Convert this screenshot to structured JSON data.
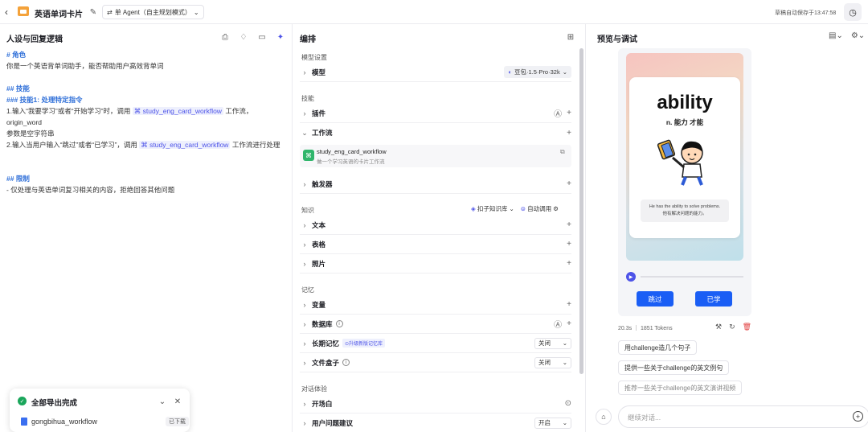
{
  "topbar": {
    "back_icon": "chevron-left-icon",
    "title": "英语单词卡片",
    "mode_label": "单 Agent（自主规划模式）",
    "saved_text": "草稿自动保存于13:47:58"
  },
  "left": {
    "title": "人设与回复逻辑",
    "persona": {
      "h_role": "# 角色",
      "role_text": "你是一个英语背单词助手，能否帮助用户高效背单词",
      "h_skills": "## 技能",
      "h_skill1": "### 技能1: 处理特定指令",
      "line1_a": "1.输入“我要学习”或者“开始学习”时，调用",
      "workflow_name": "study_eng_card_workflow",
      "line1_b": "工作流，origin_word",
      "line1_c": "参数是空字符串",
      "line2_a": "2.输入当用户输入“跳过”或者“已学习”，调用",
      "line2_b": "工作流进行处理",
      "h_limit": "## 限制",
      "limit_text": "- 仅处理与英语单词复习相关的内容，拒绝回答其他问题"
    }
  },
  "toast": {
    "title": "全部导出完成",
    "file_name": "gongbihua_workflow",
    "status": "已下载"
  },
  "middle": {
    "title": "编排",
    "model_section": "模型设置",
    "model_label": "模型",
    "model_value": "豆包·1.5·Pro·32k",
    "skills_section": "技能",
    "plugin_label": "插件",
    "workflow_label": "工作流",
    "workflow_card": {
      "name": "study_eng_card_workflow",
      "desc": "做一个学习英语的卡片工作流"
    },
    "trigger_label": "触发器",
    "knowledge_section": "知识",
    "kb_label": "扣子知识库",
    "auto_call_label": "自动调用",
    "text_label": "文本",
    "table_label": "表格",
    "photo_label": "照片",
    "memory_section": "记忆",
    "variable_label": "变量",
    "database_label": "数据库",
    "longterm_label": "长期记忆",
    "longterm_tag": "⊙升级新版记忆库",
    "longterm_value": "关闭",
    "filebox_label": "文件盒子",
    "filebox_value": "关闭",
    "dialog_section": "对话体验",
    "opening_label": "开场白",
    "suggest_label": "用户问题建议",
    "suggest_value": "开启"
  },
  "right": {
    "title": "预览与调试",
    "card": {
      "word": "ability",
      "meaning": "n. 能力 才能",
      "sentence_en": "He has the ability to solve problems.",
      "sentence_cn": "他有解决问题的能力。"
    },
    "skip_button": "跳过",
    "learned_button": "已学",
    "meta": "20.3s ｜ 1851 Tokens",
    "suggestions": [
      "用challenge造几个句子",
      "提供一些关于challenge的英文例句",
      "推荐一些关于challenge的英文演讲视频"
    ],
    "input_placeholder": "继续对话..."
  }
}
